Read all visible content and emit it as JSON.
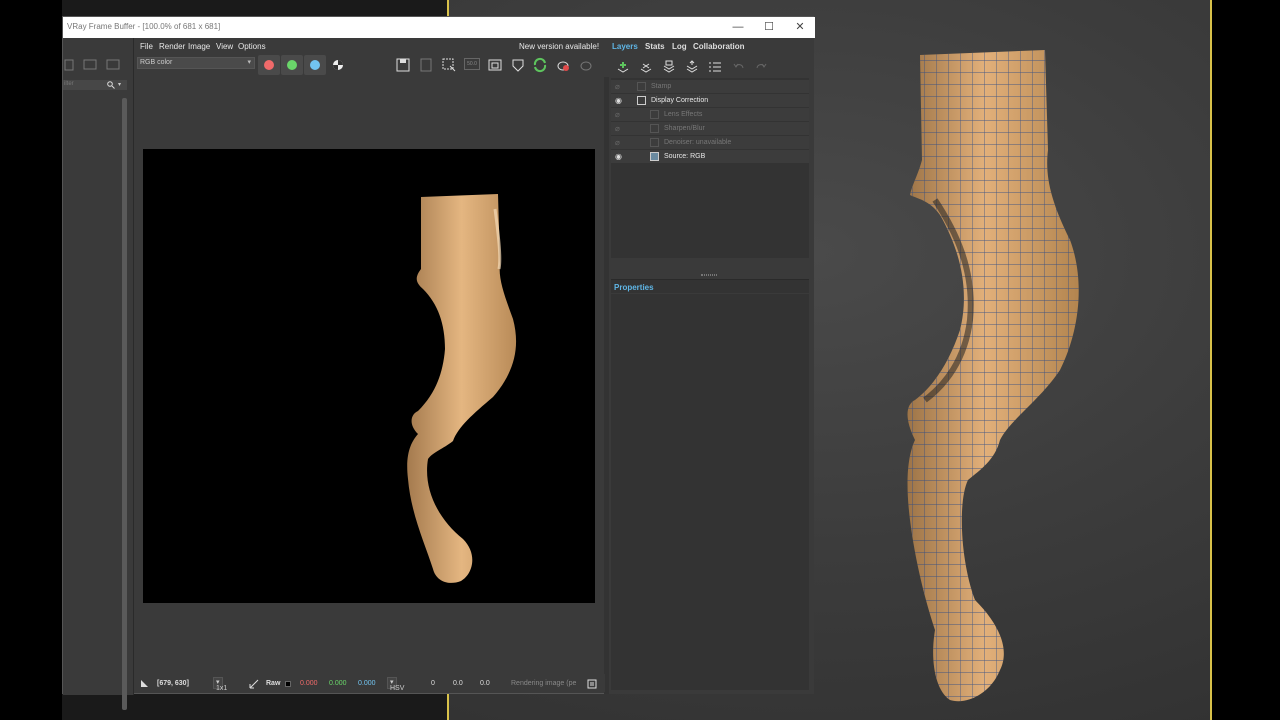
{
  "window": {
    "title": "VRay Frame Buffer - [100.0% of 681 x 681]",
    "minimize": "—",
    "maximize": "☐",
    "close": "✕"
  },
  "left_strip": {
    "search_placeholder": "ilter"
  },
  "menu": {
    "items": [
      "File",
      "Render",
      "Image",
      "View",
      "Options"
    ],
    "notice": "New version available!"
  },
  "toolbar": {
    "channel_select": "RGB color",
    "channel_buttons": [
      {
        "name": "red-channel",
        "color": "#f06a6a"
      },
      {
        "name": "green-channel",
        "color": "#6ad66a"
      },
      {
        "name": "blue-channel",
        "color": "#72c4f0"
      }
    ],
    "zoom_badge": "50.0"
  },
  "tabs": [
    "Layers",
    "Stats",
    "Log",
    "Collaboration"
  ],
  "layers": [
    {
      "label": "Stamp",
      "visible": false,
      "indent": 0
    },
    {
      "label": "Display Correction",
      "visible": true,
      "indent": 0
    },
    {
      "label": "Lens Effects",
      "visible": false,
      "indent": 1
    },
    {
      "label": "Sharpen/Blur",
      "visible": false,
      "indent": 1
    },
    {
      "label": "Denoiser: unavailable",
      "visible": false,
      "indent": 1
    },
    {
      "label": "Source: RGB",
      "visible": true,
      "indent": 1
    }
  ],
  "properties": {
    "label": "Properties"
  },
  "status": {
    "coords": "[679, 630]",
    "sample": "1x1",
    "raw": "Raw",
    "r": "0.000",
    "g": "0.000",
    "b": "0.000",
    "mode": "HSV",
    "h": "0",
    "s": "0.0",
    "v": "0.0",
    "message": "Rendering image (pe"
  },
  "colors": {
    "accent": "#5fb6e6",
    "viewport_border": "#d9c24a",
    "wood": "#d9a872"
  }
}
